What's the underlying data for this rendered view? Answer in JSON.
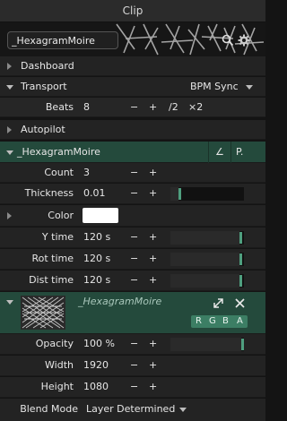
{
  "window": {
    "title": "Clip"
  },
  "search": {
    "value": "_HexagramMoire"
  },
  "sections": {
    "dashboard": "Dashboard",
    "transport": "Transport",
    "transport_mode": "BPM Sync",
    "autopilot": "Autopilot",
    "effect": "_HexagramMoire",
    "effect_btn1": "∠",
    "effect_btn2": "P."
  },
  "beats": {
    "label": "Beats",
    "value": "8",
    "minus": "−",
    "plus": "+",
    "half": "/2",
    "double": "×2"
  },
  "params": {
    "count": {
      "label": "Count",
      "value": "3"
    },
    "thickness": {
      "label": "Thickness",
      "value": "0.01",
      "level": 0.12
    },
    "color": {
      "label": "Color",
      "swatch": "#ffffff"
    },
    "ytime": {
      "label": "Y time",
      "value": "120 s",
      "level": 0.98
    },
    "rottime": {
      "label": "Rot time",
      "value": "120 s",
      "level": 0.98
    },
    "disttime": {
      "label": "Dist time",
      "value": "120 s",
      "level": 0.98
    }
  },
  "clip_card": {
    "name": "_HexagramMoire",
    "channels": [
      "R",
      "G",
      "B",
      "A"
    ]
  },
  "layer": {
    "opacity": {
      "label": "Opacity",
      "value": "100 %",
      "level": 1.0
    },
    "width": {
      "label": "Width",
      "value": "1920"
    },
    "height": {
      "label": "Height",
      "value": "1080"
    },
    "blend": {
      "label": "Blend Mode",
      "value": "Layer Determined"
    }
  },
  "colors": {
    "accent": "#4f9f7f",
    "section_green": "#244a3c"
  },
  "icons": [
    "search-icon",
    "gear-icon",
    "expand-icon",
    "close-icon",
    "chevron-down-icon",
    "triangle-right-icon"
  ]
}
